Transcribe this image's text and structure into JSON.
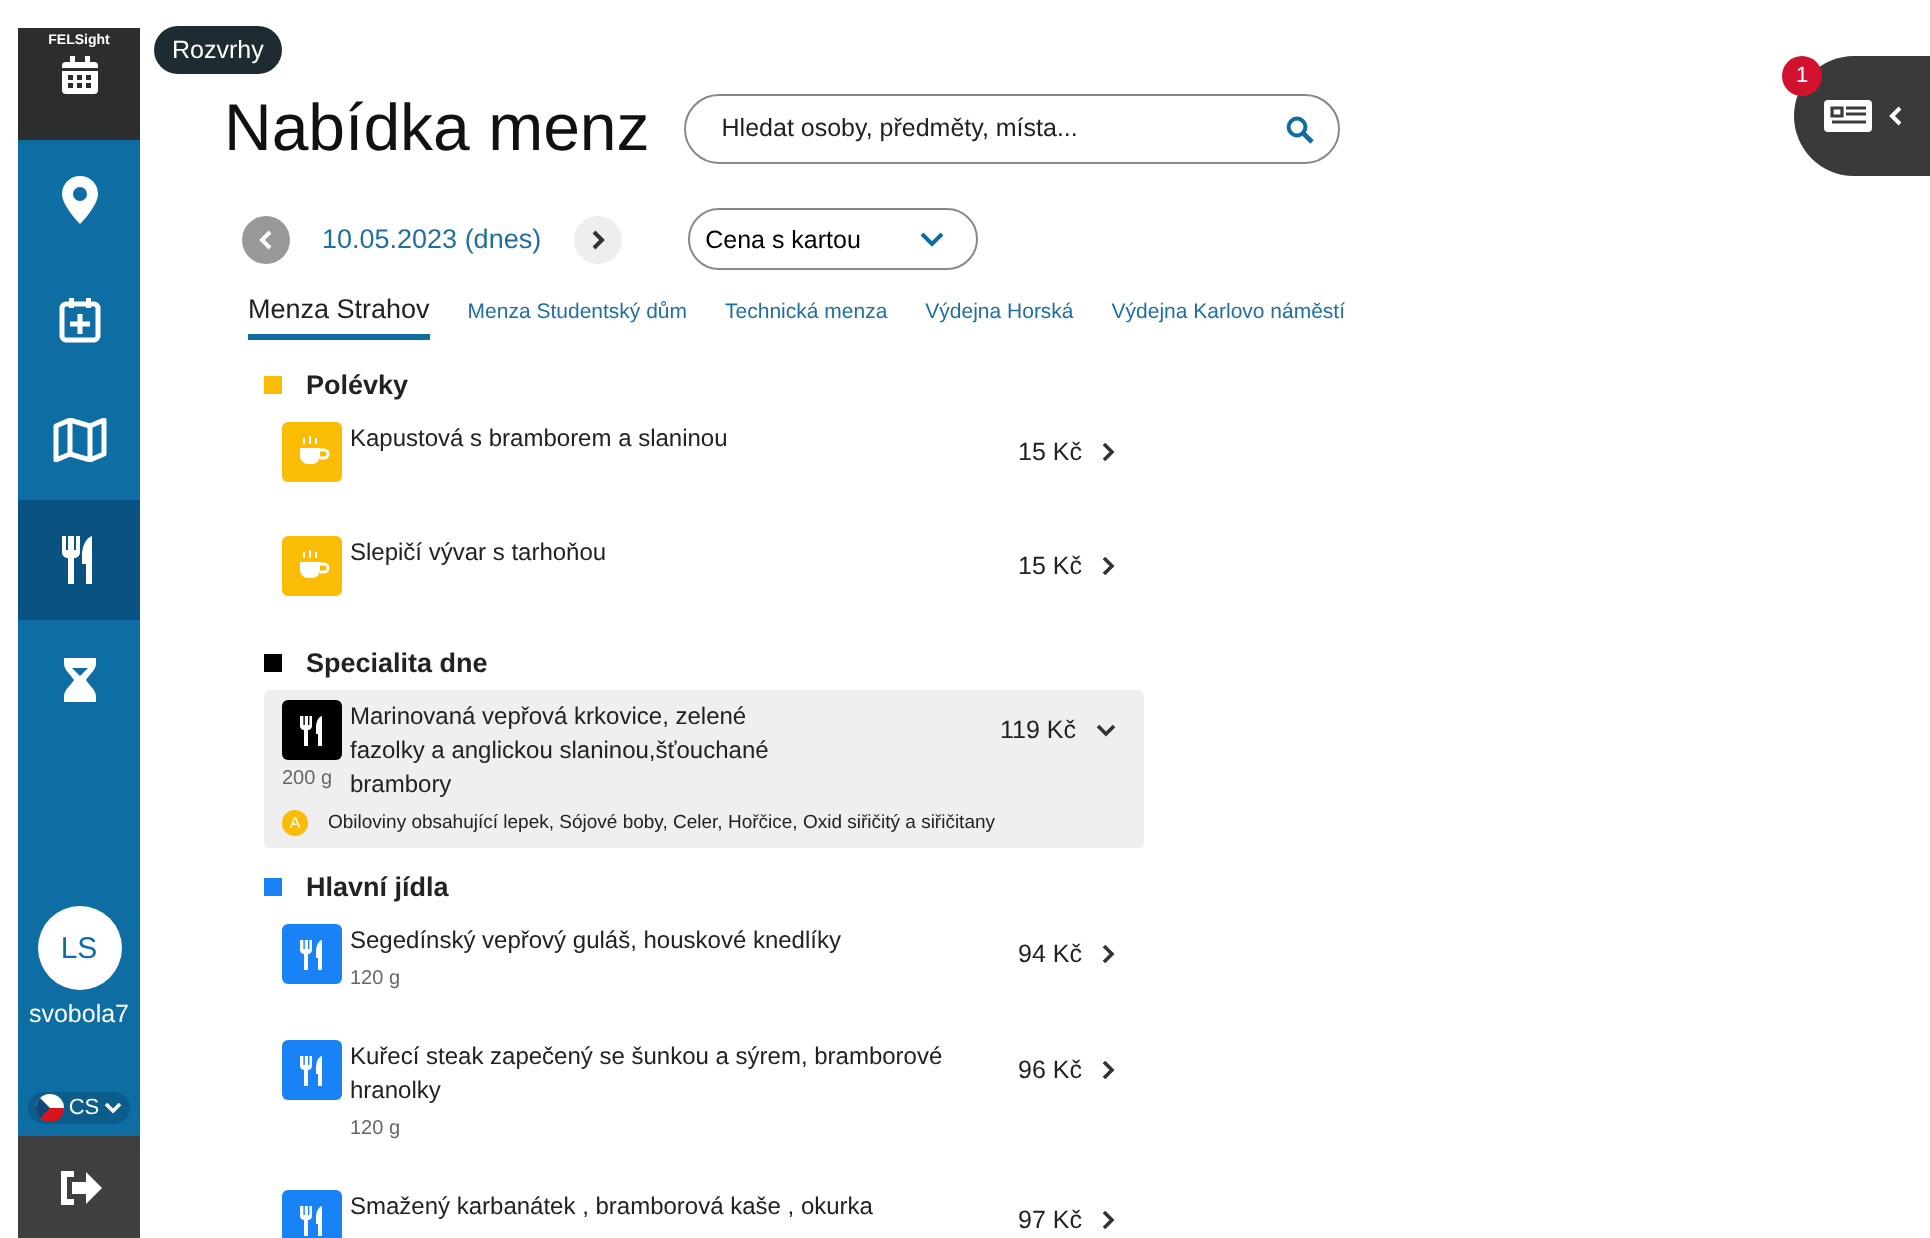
{
  "sidebar": {
    "brand": "FELSight",
    "items": [
      {
        "kind": "location",
        "selected": false
      },
      {
        "kind": "calendar-plus",
        "selected": false
      },
      {
        "kind": "map",
        "selected": false
      },
      {
        "kind": "food",
        "selected": true
      },
      {
        "kind": "hourglass",
        "selected": false
      }
    ],
    "user": {
      "initials": "LS",
      "username": "svobola7"
    },
    "language": "CS"
  },
  "tooltip": "Rozvrhy",
  "title": "Nabídka menz",
  "search": {
    "placeholder": "Hledat osoby, předměty, místa..."
  },
  "notifications": {
    "count": "1"
  },
  "date": "10.05.2023 (dnes)",
  "price_select": "Cena s kartou",
  "tabs": [
    {
      "label": "Menza Strahov",
      "selected": true
    },
    {
      "label": "Menza Studentský dům",
      "selected": false
    },
    {
      "label": "Technická menza",
      "selected": false
    },
    {
      "label": "Výdejna Horská",
      "selected": false
    },
    {
      "label": "Výdejna Karlovo náměstí",
      "selected": false
    }
  ],
  "categories": [
    {
      "name": "Polévky",
      "color": "#fbbc05",
      "kind": "soup",
      "items": [
        {
          "name": "Kapustová s bramborem a  slaninou",
          "price": "15 Kč",
          "expanded": false
        },
        {
          "name": "Slepičí vývar s tarhoňou",
          "price": "15 Kč",
          "expanded": false
        }
      ]
    },
    {
      "name": "Specialita dne",
      "color": "#000000",
      "kind": "meal",
      "items": [
        {
          "name": "Marinovaná vepřová krkovice, zelené fazolky a anglickou slaninou,šťouchané brambory",
          "price": "119 Kč",
          "weight": "200 g",
          "expanded": true,
          "allergen_badge": "A",
          "allergens": "Obiloviny obsahující lepek, Sójové boby, Celer, Hořčice, Oxid siřičitý a siřičitany"
        }
      ]
    },
    {
      "name": "Hlavní jídla",
      "color": "#1a82f7",
      "kind": "meal",
      "items": [
        {
          "name": "Segedínský vepřový guláš, houskové knedlíky",
          "price": "94 Kč",
          "weight": "120 g",
          "expanded": false
        },
        {
          "name": "Kuřecí steak zapečený se  šunkou a sýrem, bramborové hranolky",
          "price": "96 Kč",
          "weight": "120 g",
          "expanded": false
        },
        {
          "name": "Smažený karbanátek , bramborová kaše , okurka",
          "price": "97 Kč",
          "expanded": false
        }
      ]
    }
  ]
}
